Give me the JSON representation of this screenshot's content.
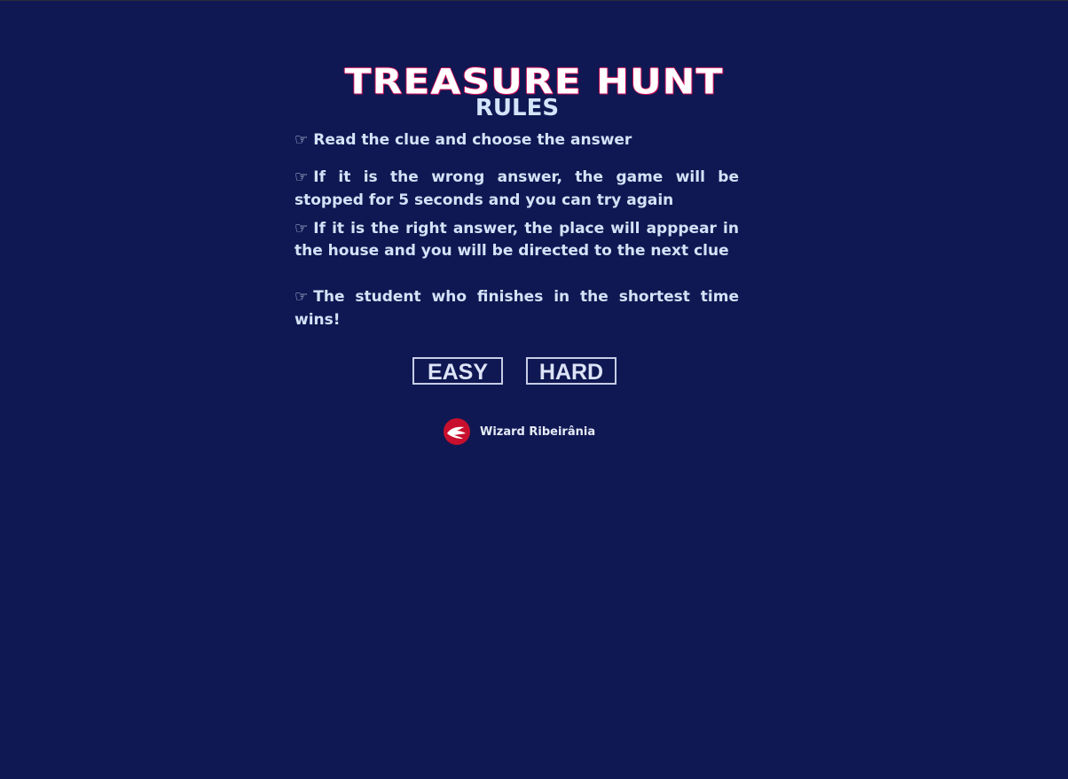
{
  "header": {
    "title": "TREASURE HUNT",
    "subtitle": "RULES"
  },
  "rules": {
    "bullet_icon": "pointing-hand-icon",
    "bullet_glyph": "☞",
    "items": [
      "Read the clue and choose the answer",
      "If it is the wrong answer, the game will be stopped for 5 seconds and you can try again",
      "If it is the right answer, the place will apppear in the house and you will be directed to the next clue",
      "The student who finishes in the shortest time wins!"
    ]
  },
  "buttons": {
    "easy_label": "EASY",
    "hard_label": "HARD"
  },
  "footer": {
    "logo_icon": "eagle-logo-icon",
    "brand_name": "Wizard Ribeirânia"
  },
  "colors": {
    "background": "#0f1852",
    "title": "#ffffff",
    "title_outline": "#d0105a",
    "text": "#d4e2f8",
    "logo_red": "#c8102e"
  }
}
